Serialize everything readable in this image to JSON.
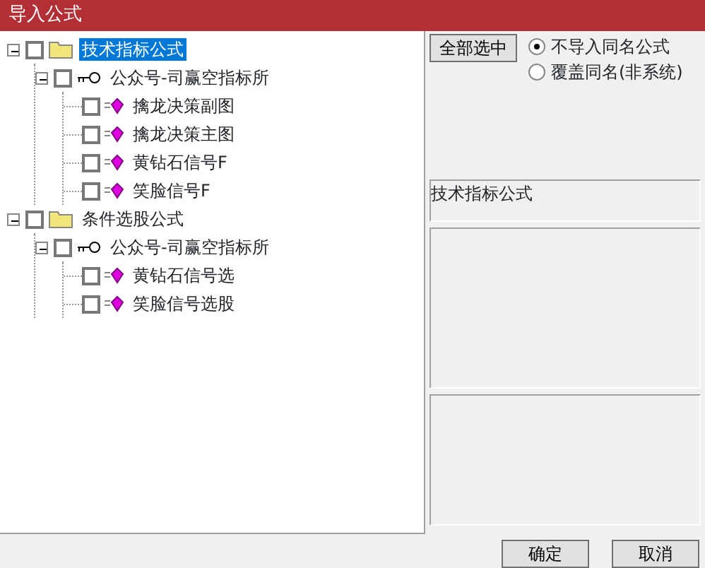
{
  "window": {
    "title": "导入公式"
  },
  "tree": [
    {
      "label": "技术指标公式",
      "kind": "folder",
      "expanded": true,
      "checked": false,
      "selected": true,
      "children": [
        {
          "label": "公众号-司赢空指标所",
          "kind": "group",
          "expanded": true,
          "checked": false,
          "selected": false,
          "children": [
            {
              "label": "擒龙决策副图",
              "kind": "formula",
              "checked": false,
              "selected": false
            },
            {
              "label": "擒龙决策主图",
              "kind": "formula",
              "checked": false,
              "selected": false
            },
            {
              "label": "黄钻石信号F",
              "kind": "formula",
              "checked": false,
              "selected": false
            },
            {
              "label": "笑脸信号F",
              "kind": "formula",
              "checked": false,
              "selected": false
            }
          ]
        }
      ]
    },
    {
      "label": "条件选股公式",
      "kind": "folder",
      "expanded": true,
      "checked": false,
      "selected": false,
      "children": [
        {
          "label": "公众号-司赢空指标所",
          "kind": "group",
          "expanded": true,
          "checked": false,
          "selected": false,
          "children": [
            {
              "label": "黄钻石信号选",
              "kind": "formula",
              "checked": false,
              "selected": false
            },
            {
              "label": "笑脸信号选股",
              "kind": "formula",
              "checked": false,
              "selected": false
            }
          ]
        }
      ]
    }
  ],
  "select_all_button": "全部选中",
  "options": [
    {
      "label": "不导入同名公式",
      "selected": true
    },
    {
      "label": "覆盖同名(非系统)",
      "selected": false
    }
  ],
  "info_box": "技术指标公式",
  "buttons": [
    "确定",
    "取消"
  ]
}
